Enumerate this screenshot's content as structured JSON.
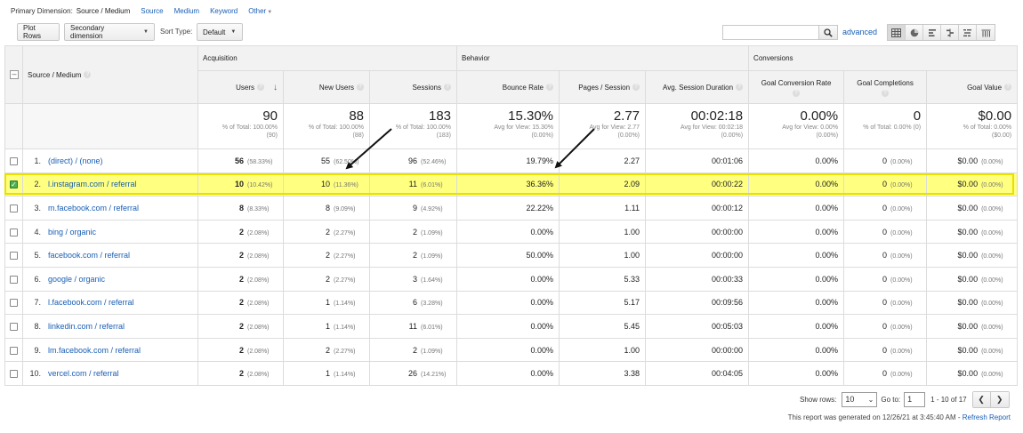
{
  "dimension_bar": {
    "label": "Primary Dimension:",
    "current": "Source / Medium",
    "links": [
      "Source",
      "Medium",
      "Keyword"
    ],
    "other": "Other"
  },
  "toolbar": {
    "plot_rows": "Plot Rows",
    "secondary_dimension": "Secondary dimension",
    "sort_type_label": "Sort Type:",
    "sort_type_value": "Default",
    "search_value": "",
    "advanced": "advanced",
    "view_icons": [
      "table-view-icon",
      "pie-view-icon",
      "performance-view-icon",
      "comparison-view-icon",
      "term-cloud-view-icon",
      "pivot-view-icon"
    ]
  },
  "table": {
    "dimension_header": "Source / Medium",
    "groups": [
      "Acquisition",
      "Behavior",
      "Conversions"
    ],
    "columns": [
      "Users",
      "New Users",
      "Sessions",
      "Bounce Rate",
      "Pages / Session",
      "Avg. Session Duration",
      "Goal Conversion Rate",
      "Goal Completions",
      "Goal Value"
    ],
    "totals": [
      {
        "value": "90",
        "sub1": "% of Total: 100.00%",
        "sub2": "(90)"
      },
      {
        "value": "88",
        "sub1": "% of Total: 100.00%",
        "sub2": "(88)"
      },
      {
        "value": "183",
        "sub1": "% of Total: 100.00%",
        "sub2": "(183)"
      },
      {
        "value": "15.30%",
        "sub1": "Avg for View: 15.30%",
        "sub2": "(0.00%)"
      },
      {
        "value": "2.77",
        "sub1": "Avg for View: 2.77",
        "sub2": "(0.00%)"
      },
      {
        "value": "00:02:18",
        "sub1": "Avg for View: 00:02:18",
        "sub2": "(0.00%)"
      },
      {
        "value": "0.00%",
        "sub1": "Avg for View: 0.00%",
        "sub2": "(0.00%)"
      },
      {
        "value": "0",
        "sub1": "% of Total: 0.00% (0)",
        "sub2": ""
      },
      {
        "value": "$0.00",
        "sub1": "% of Total: 0.00%",
        "sub2": "($0.00)"
      }
    ],
    "rows": [
      {
        "idx": "1.",
        "source": "(direct) / (none)",
        "checked": false,
        "users": "56",
        "users_pct": "(58.33%)",
        "new_users": "55",
        "new_users_pct": "(62.50%)",
        "sessions": "96",
        "sessions_pct": "(52.46%)",
        "bounce": "19.79%",
        "pages": "2.27",
        "duration": "00:01:06",
        "conv_rate": "0.00%",
        "completions": "0",
        "completions_pct": "(0.00%)",
        "value": "$0.00",
        "value_pct": "(0.00%)"
      },
      {
        "idx": "2.",
        "source": "l.instagram.com / referral",
        "checked": true,
        "users": "10",
        "users_pct": "(10.42%)",
        "new_users": "10",
        "new_users_pct": "(11.36%)",
        "sessions": "11",
        "sessions_pct": "(6.01%)",
        "bounce": "36.36%",
        "pages": "2.09",
        "duration": "00:00:22",
        "conv_rate": "0.00%",
        "completions": "0",
        "completions_pct": "(0.00%)",
        "value": "$0.00",
        "value_pct": "(0.00%)"
      },
      {
        "idx": "3.",
        "source": "m.facebook.com / referral",
        "checked": false,
        "users": "8",
        "users_pct": "(8.33%)",
        "new_users": "8",
        "new_users_pct": "(9.09%)",
        "sessions": "9",
        "sessions_pct": "(4.92%)",
        "bounce": "22.22%",
        "pages": "1.11",
        "duration": "00:00:12",
        "conv_rate": "0.00%",
        "completions": "0",
        "completions_pct": "(0.00%)",
        "value": "$0.00",
        "value_pct": "(0.00%)"
      },
      {
        "idx": "4.",
        "source": "bing / organic",
        "checked": false,
        "users": "2",
        "users_pct": "(2.08%)",
        "new_users": "2",
        "new_users_pct": "(2.27%)",
        "sessions": "2",
        "sessions_pct": "(1.09%)",
        "bounce": "0.00%",
        "pages": "1.00",
        "duration": "00:00:00",
        "conv_rate": "0.00%",
        "completions": "0",
        "completions_pct": "(0.00%)",
        "value": "$0.00",
        "value_pct": "(0.00%)"
      },
      {
        "idx": "5.",
        "source": "facebook.com / referral",
        "checked": false,
        "users": "2",
        "users_pct": "(2.08%)",
        "new_users": "2",
        "new_users_pct": "(2.27%)",
        "sessions": "2",
        "sessions_pct": "(1.09%)",
        "bounce": "50.00%",
        "pages": "1.00",
        "duration": "00:00:00",
        "conv_rate": "0.00%",
        "completions": "0",
        "completions_pct": "(0.00%)",
        "value": "$0.00",
        "value_pct": "(0.00%)"
      },
      {
        "idx": "6.",
        "source": "google / organic",
        "checked": false,
        "users": "2",
        "users_pct": "(2.08%)",
        "new_users": "2",
        "new_users_pct": "(2.27%)",
        "sessions": "3",
        "sessions_pct": "(1.64%)",
        "bounce": "0.00%",
        "pages": "5.33",
        "duration": "00:00:33",
        "conv_rate": "0.00%",
        "completions": "0",
        "completions_pct": "(0.00%)",
        "value": "$0.00",
        "value_pct": "(0.00%)"
      },
      {
        "idx": "7.",
        "source": "l.facebook.com / referral",
        "checked": false,
        "users": "2",
        "users_pct": "(2.08%)",
        "new_users": "1",
        "new_users_pct": "(1.14%)",
        "sessions": "6",
        "sessions_pct": "(3.28%)",
        "bounce": "0.00%",
        "pages": "5.17",
        "duration": "00:09:56",
        "conv_rate": "0.00%",
        "completions": "0",
        "completions_pct": "(0.00%)",
        "value": "$0.00",
        "value_pct": "(0.00%)"
      },
      {
        "idx": "8.",
        "source": "linkedin.com / referral",
        "checked": false,
        "users": "2",
        "users_pct": "(2.08%)",
        "new_users": "1",
        "new_users_pct": "(1.14%)",
        "sessions": "11",
        "sessions_pct": "(6.01%)",
        "bounce": "0.00%",
        "pages": "5.45",
        "duration": "00:05:03",
        "conv_rate": "0.00%",
        "completions": "0",
        "completions_pct": "(0.00%)",
        "value": "$0.00",
        "value_pct": "(0.00%)"
      },
      {
        "idx": "9.",
        "source": "lm.facebook.com / referral",
        "checked": false,
        "users": "2",
        "users_pct": "(2.08%)",
        "new_users": "2",
        "new_users_pct": "(2.27%)",
        "sessions": "2",
        "sessions_pct": "(1.09%)",
        "bounce": "0.00%",
        "pages": "1.00",
        "duration": "00:00:00",
        "conv_rate": "0.00%",
        "completions": "0",
        "completions_pct": "(0.00%)",
        "value": "$0.00",
        "value_pct": "(0.00%)"
      },
      {
        "idx": "10.",
        "source": "vercel.com / referral",
        "checked": false,
        "users": "2",
        "users_pct": "(2.08%)",
        "new_users": "1",
        "new_users_pct": "(1.14%)",
        "sessions": "26",
        "sessions_pct": "(14.21%)",
        "bounce": "0.00%",
        "pages": "3.38",
        "duration": "00:04:05",
        "conv_rate": "0.00%",
        "completions": "0",
        "completions_pct": "(0.00%)",
        "value": "$0.00",
        "value_pct": "(0.00%)"
      }
    ]
  },
  "pager": {
    "show_rows_label": "Show rows:",
    "show_rows_value": "10",
    "goto_label": "Go to:",
    "goto_value": "1",
    "range": "1 - 10 of 17"
  },
  "footer": {
    "text": "This report was generated on 12/26/21 at 3:45:40 AM - ",
    "refresh": "Refresh Report"
  },
  "colors": {
    "link": "#1a5fb4",
    "highlight": "#ffff80",
    "highlight_border": "#e8e000",
    "checkbox_on": "#4caf50"
  }
}
